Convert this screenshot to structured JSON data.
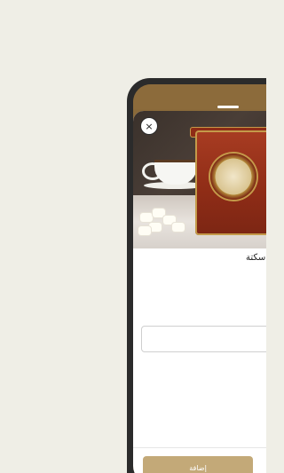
{
  "sheet": {
    "close_glyph": "×",
    "title": "سكتة",
    "note_input": {
      "value": "",
      "placeholder": ""
    },
    "add_button_label": "إضافة"
  },
  "colors": {
    "background": "#efeee6",
    "phone_frame": "#2b2b2b",
    "status_bar": "#8c6b3b",
    "button": "#c3a978",
    "button_text": "#ffffff"
  },
  "icons": {
    "close": "close-icon"
  }
}
